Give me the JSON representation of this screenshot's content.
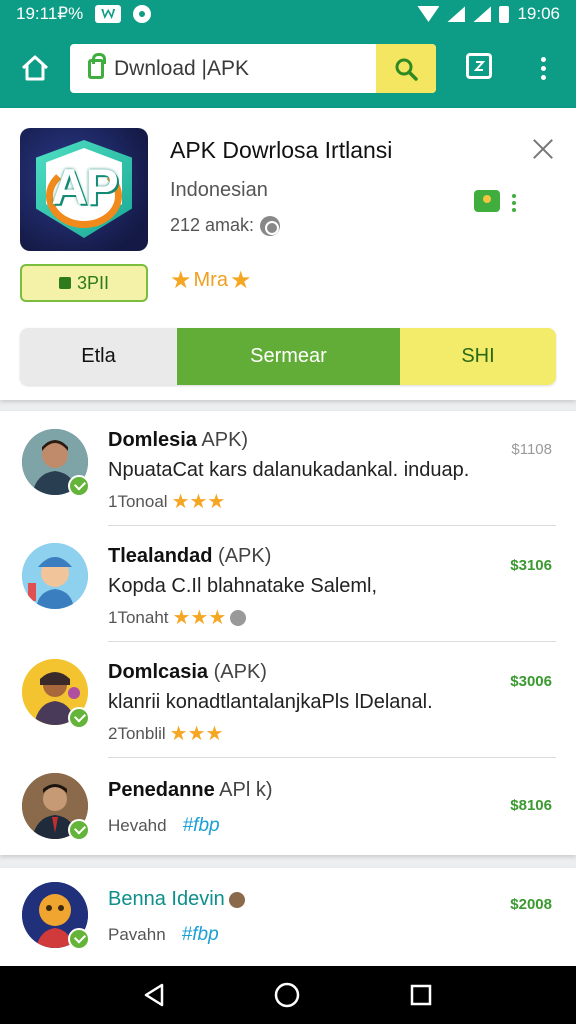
{
  "status_bar": {
    "left_time": "19:11₽%",
    "right_time": "19:06"
  },
  "toolbar": {
    "search_text": "Dwnload  |APK"
  },
  "app": {
    "title": "APK Dowrlosa Irtlansi",
    "subtitle": "Indonesian",
    "meta": "212 amak:",
    "icon_text": "AP",
    "rate_button": "3PII",
    "rating_label": "Mra",
    "segments": [
      "Etla",
      "Sermear",
      "SHI"
    ]
  },
  "list": [
    {
      "name": "Domlesia",
      "suffix": "APK)",
      "desc": "NpuataCat kars dalanukadankal. induap.",
      "sub": "1Tonoal",
      "stars": 3,
      "price": "$1108"
    },
    {
      "name": "Tlealandad",
      "suffix": "(APK)",
      "desc": "Kopda C.Il blahnatake Saleml,",
      "sub": "1Tonaht",
      "stars": 3,
      "price": "$3106"
    },
    {
      "name": "Domlcasia",
      "suffix": "(APK)",
      "desc": "klanrii konadtlantalanjkaPls lDelanal.",
      "sub": "2Tonblil",
      "stars": 3,
      "price": "$3006"
    },
    {
      "name": "Penedanne",
      "suffix": "APl k)",
      "desc": "",
      "sub": "Hevahd",
      "tag": "#fbp",
      "price": "$8106"
    },
    {
      "name": "Benna Idevin",
      "suffix": "",
      "desc": "",
      "sub": "Pavahn",
      "tag": "#fbp",
      "price": "$2008"
    }
  ],
  "colors": {
    "primary": "#0d9c86",
    "accent": "#62ad37",
    "yellow": "#f3ec6a",
    "star": "#f5a623"
  }
}
